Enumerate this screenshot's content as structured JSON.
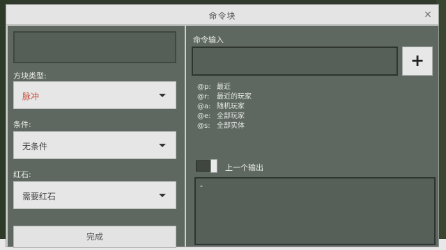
{
  "window": {
    "title": "命令块",
    "close_glyph": "×"
  },
  "left": {
    "block_type_label": "方块类型:",
    "block_type_value": "脉冲",
    "condition_label": "条件:",
    "condition_value": "无条件",
    "redstone_label": "红石:",
    "redstone_value": "需要红石",
    "done_label": "完成"
  },
  "right": {
    "command_label": "命令输入",
    "command_value": "",
    "add_glyph": "+",
    "hints": [
      {
        "key": "@p:",
        "text": "最近"
      },
      {
        "key": "@r:",
        "text": "最近的玩家"
      },
      {
        "key": "@a:",
        "text": "随机玩家"
      },
      {
        "key": "@e:",
        "text": "全部玩家"
      },
      {
        "key": "@s:",
        "text": "全部实体"
      }
    ],
    "previous_output_label": "上一个输出",
    "output_text": "-"
  },
  "colors": {
    "panel": "#5e6760",
    "frame": "#cfd1cf",
    "pulse_red": "#cc4c3c"
  }
}
